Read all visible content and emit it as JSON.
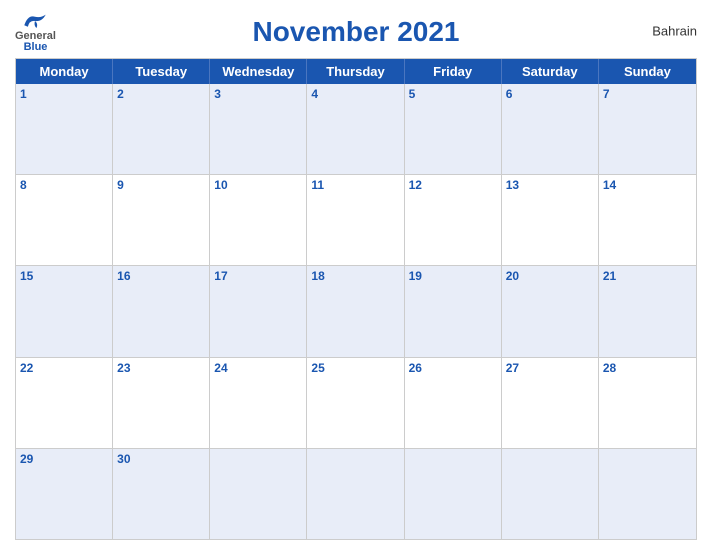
{
  "header": {
    "title": "November 2021",
    "country": "Bahrain",
    "logo": {
      "general": "General",
      "blue": "Blue"
    }
  },
  "calendar": {
    "day_headers": [
      "Monday",
      "Tuesday",
      "Wednesday",
      "Thursday",
      "Friday",
      "Saturday",
      "Sunday"
    ],
    "weeks": [
      {
        "shaded": true,
        "days": [
          {
            "number": "1",
            "empty": false
          },
          {
            "number": "2",
            "empty": false
          },
          {
            "number": "3",
            "empty": false
          },
          {
            "number": "4",
            "empty": false
          },
          {
            "number": "5",
            "empty": false
          },
          {
            "number": "6",
            "empty": false
          },
          {
            "number": "7",
            "empty": false
          }
        ]
      },
      {
        "shaded": false,
        "days": [
          {
            "number": "8",
            "empty": false
          },
          {
            "number": "9",
            "empty": false
          },
          {
            "number": "10",
            "empty": false
          },
          {
            "number": "11",
            "empty": false
          },
          {
            "number": "12",
            "empty": false
          },
          {
            "number": "13",
            "empty": false
          },
          {
            "number": "14",
            "empty": false
          }
        ]
      },
      {
        "shaded": true,
        "days": [
          {
            "number": "15",
            "empty": false
          },
          {
            "number": "16",
            "empty": false
          },
          {
            "number": "17",
            "empty": false
          },
          {
            "number": "18",
            "empty": false
          },
          {
            "number": "19",
            "empty": false
          },
          {
            "number": "20",
            "empty": false
          },
          {
            "number": "21",
            "empty": false
          }
        ]
      },
      {
        "shaded": false,
        "days": [
          {
            "number": "22",
            "empty": false
          },
          {
            "number": "23",
            "empty": false
          },
          {
            "number": "24",
            "empty": false
          },
          {
            "number": "25",
            "empty": false
          },
          {
            "number": "26",
            "empty": false
          },
          {
            "number": "27",
            "empty": false
          },
          {
            "number": "28",
            "empty": false
          }
        ]
      },
      {
        "shaded": true,
        "days": [
          {
            "number": "29",
            "empty": false
          },
          {
            "number": "30",
            "empty": false
          },
          {
            "number": "",
            "empty": true
          },
          {
            "number": "",
            "empty": true
          },
          {
            "number": "",
            "empty": true
          },
          {
            "number": "",
            "empty": true
          },
          {
            "number": "",
            "empty": true
          }
        ]
      }
    ]
  }
}
